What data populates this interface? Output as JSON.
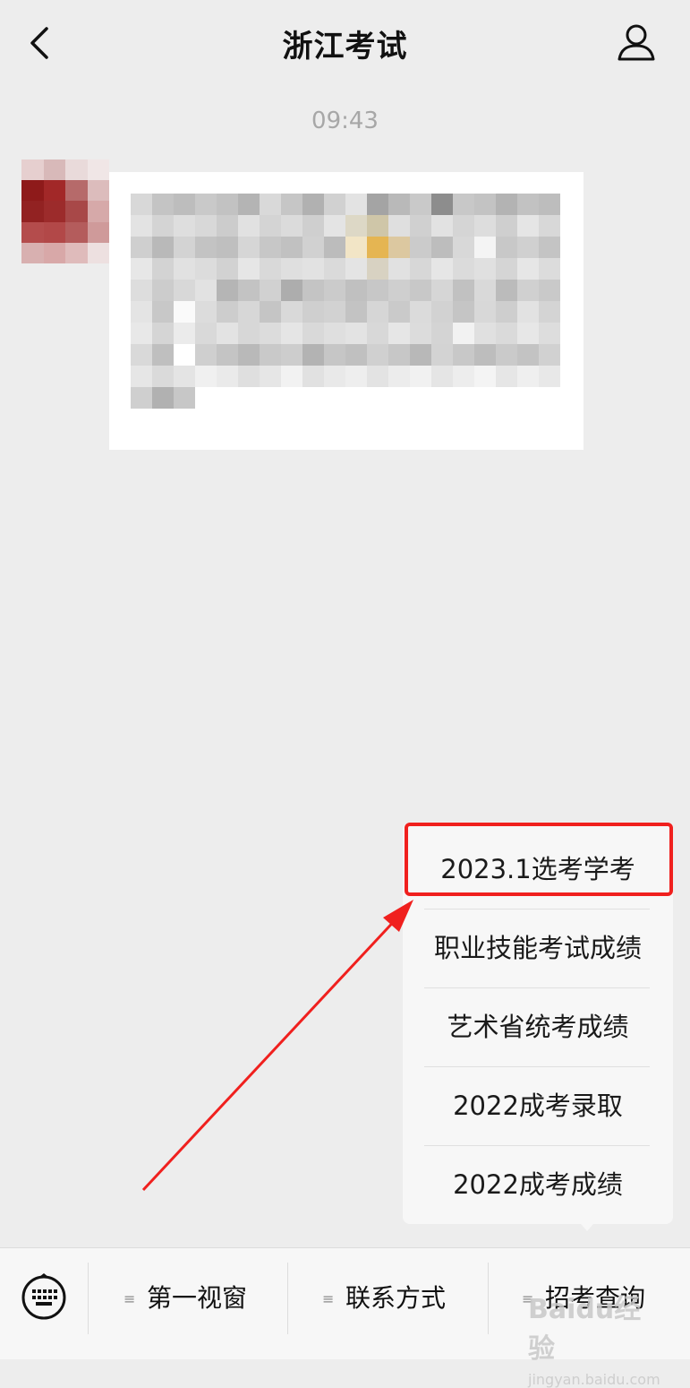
{
  "header": {
    "title": "浙江考试",
    "back_icon": "chevron-left-icon",
    "profile_icon": "user-icon"
  },
  "chat": {
    "timestamp": "09:43"
  },
  "popup_menu": {
    "items": [
      {
        "label": "2023.1选考学考"
      },
      {
        "label": "职业技能考试成绩"
      },
      {
        "label": "艺术省统考成绩"
      },
      {
        "label": "2022成考录取"
      },
      {
        "label": "2022成考成绩"
      }
    ]
  },
  "annotation": {
    "highlight_color": "#f0201e"
  },
  "bottom_menu": {
    "keyboard_icon": "keyboard-icon",
    "items": [
      {
        "label": "第一视窗"
      },
      {
        "label": "联系方式"
      },
      {
        "label": "招考查询"
      }
    ]
  },
  "watermark": {
    "top": "Baidu经验",
    "bottom": "jingyan.baidu.com"
  }
}
